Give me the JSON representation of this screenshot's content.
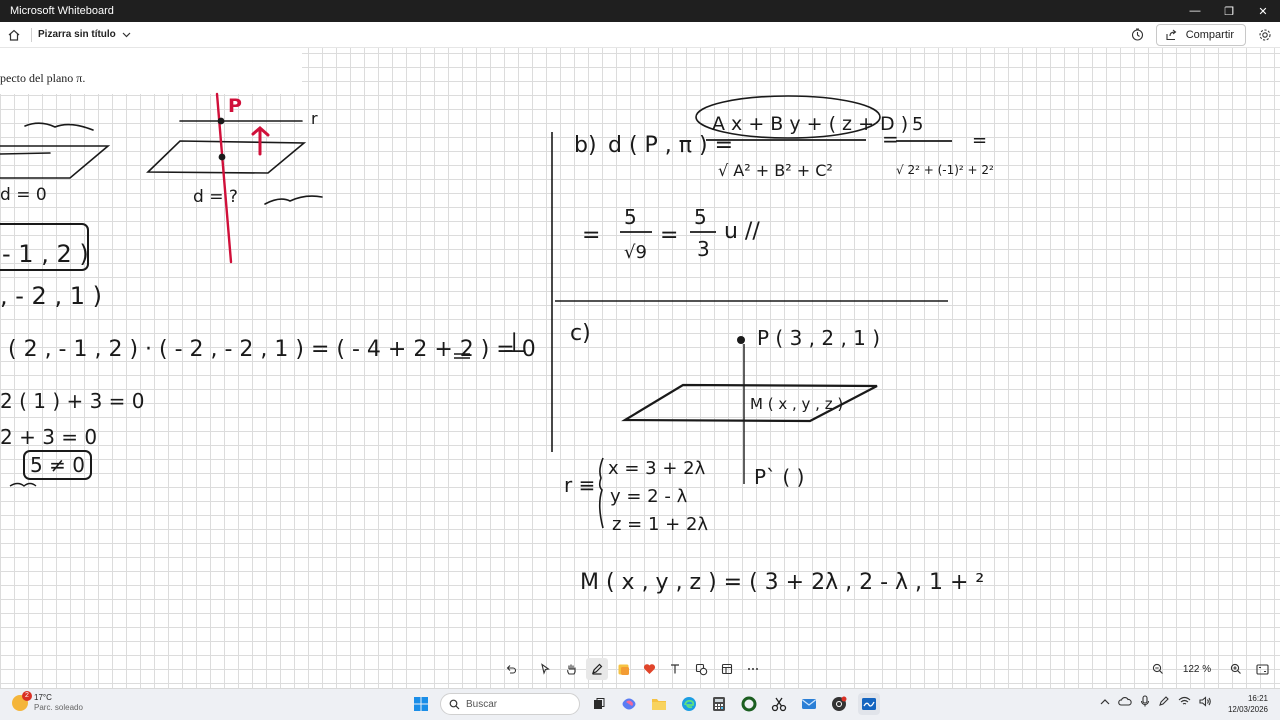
{
  "window": {
    "title": "Microsoft Whiteboard",
    "minimize": "—",
    "restore": "❐",
    "close": "✕"
  },
  "header": {
    "board_title": "Pizarra sin título",
    "share_label": "Compartir"
  },
  "pasted_text": "pecto del plano π.",
  "ink_left": {
    "line_label": "r",
    "point_label": "P",
    "dist_d0": "d = 0",
    "dist_dq": "d = ?",
    "box1": "- 1 , 2 )",
    "row2": ", - 2 , 1 )",
    "dot_eq": "( 2 , - 1 , 2 ) · ( - 2 , - 2 , 1 ) =  ( - 4  + 2  + 2 ) = 0",
    "perp": "⊥",
    "eq_a": "2 ( 1 ) + 3 = 0",
    "eq_b": "2 + 3  = 0",
    "box2": "5 ≠ 0"
  },
  "ink_right": {
    "b_label": "b)",
    "d_label": "d ( P , π ) =",
    "numerator": "A x + B y + ( z + D )",
    "denominator": "√ A² + B² + C²",
    "eq_num": "5",
    "eq_den": "√ 2² + (-1)² + 2²",
    "trailing_eq": "=",
    "result_prefix": "=",
    "res_num": "5",
    "res_den": "√9",
    "res_mid": "=",
    "res_num2": "5",
    "res_den2": "3",
    "res_unit": "u //",
    "c_label": "c)",
    "point_P": "P ( 3 , 2 , 1 )",
    "point_M": "M ( x , y , z )",
    "point_Pp": "P` (       )",
    "r_label": "r ≡",
    "param_x": "x = 3 + 2λ",
    "param_y": "y = 2 - λ",
    "param_z": "z = 1 + 2λ",
    "m_expr": "M ( x , y , z ) = ( 3 + 2λ , 2 - λ , 1 + ²"
  },
  "bottom_toolbar": {
    "zoom_value": "122 %"
  },
  "taskbar": {
    "weather_temp": "17°C",
    "weather_desc": "Parc. soleado",
    "weather_badge": "2",
    "search_placeholder": "Buscar",
    "time": "16:21",
    "date": "12/03/2026"
  },
  "colors": {
    "ink": "#1a1a1a",
    "red_ink": "#d0103a",
    "titlebar": "#1f1f1f",
    "grid": "#dcdcdc"
  }
}
